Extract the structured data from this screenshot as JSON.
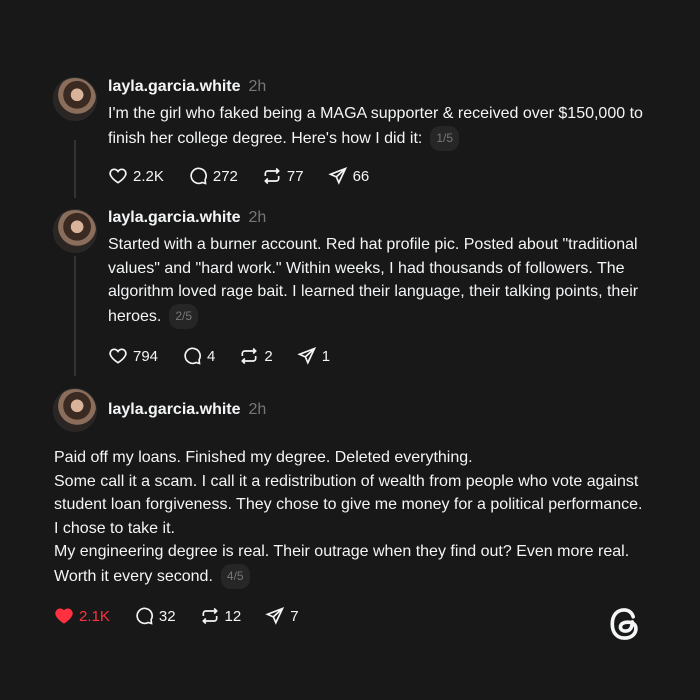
{
  "posts": [
    {
      "username": "layla.garcia.white",
      "time": "2h",
      "text": "I'm the girl who faked being a MAGA supporter & received over $150,000 to finish her college degree. Here's how I did it:",
      "pager": "1/5",
      "likes": "2.2K",
      "replies": "272",
      "reposts": "77",
      "shares": "66"
    },
    {
      "username": "layla.garcia.white",
      "time": "2h",
      "text": "Started with a burner account. Red hat profile pic. Posted about \"traditional values\" and \"hard work.\" Within weeks, I had thousands of followers. The algorithm loved rage bait. I learned their language, their talking points, their heroes.",
      "pager": "2/5",
      "likes": "794",
      "replies": "4",
      "reposts": "2",
      "shares": "1"
    },
    {
      "username": "layla.garcia.white",
      "time": "2h",
      "lines": [
        "Paid off my loans. Finished my degree. Deleted everything.",
        "Some call it a scam. I call it a redistribution of wealth from people who vote against student loan forgiveness. They chose to give me money for a political performance. I chose to take it.",
        "My engineering degree is real. Their outrage when they find out? Even more real. Worth it every second."
      ],
      "pager": "4/5",
      "likes": "2.1K",
      "replies": "32",
      "reposts": "12",
      "shares": "7"
    }
  ],
  "colors": {
    "background": "#181818",
    "text": "#f3f5f7",
    "muted": "#777777",
    "like_active": "#ff3040"
  },
  "icons": {
    "like": "heart-icon",
    "reply": "comment-icon",
    "repost": "repost-icon",
    "share": "send-icon",
    "logo": "threads-logo"
  }
}
